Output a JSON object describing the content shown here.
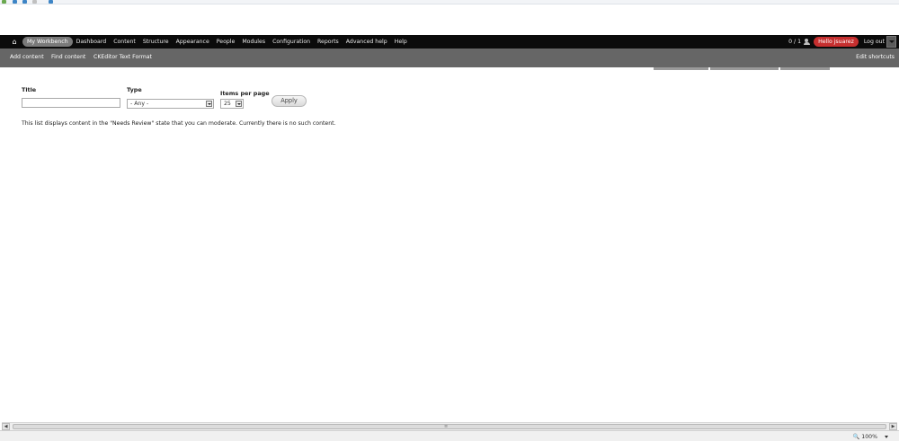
{
  "toolbar": {
    "menu": [
      "My Workbench",
      "Dashboard",
      "Content",
      "Structure",
      "Appearance",
      "People",
      "Modules",
      "Configuration",
      "Reports",
      "Advanced help",
      "Help"
    ],
    "count": "0 / 1",
    "hello": "Hello jsuarez",
    "logout": "Log out"
  },
  "shortcuts": {
    "items": [
      "Add content",
      "Find content",
      "CKEditor Text Format"
    ],
    "edit": "Edit shortcuts"
  },
  "filters": {
    "title_label": "Title",
    "title_value": "",
    "type_label": "Type",
    "type_value": "- Any -",
    "ipp_label": "Items per page",
    "ipp_value": "25",
    "apply": "Apply"
  },
  "message": "This list displays content in the \"Needs Review\" state that you can moderate. Currently there is no such content.",
  "status": {
    "zoom": "100%"
  },
  "colors": {
    "toolbar_bg": "#0b0b0b",
    "shortcuts_bg": "#666666",
    "hello_badge": "#c62f2f"
  }
}
